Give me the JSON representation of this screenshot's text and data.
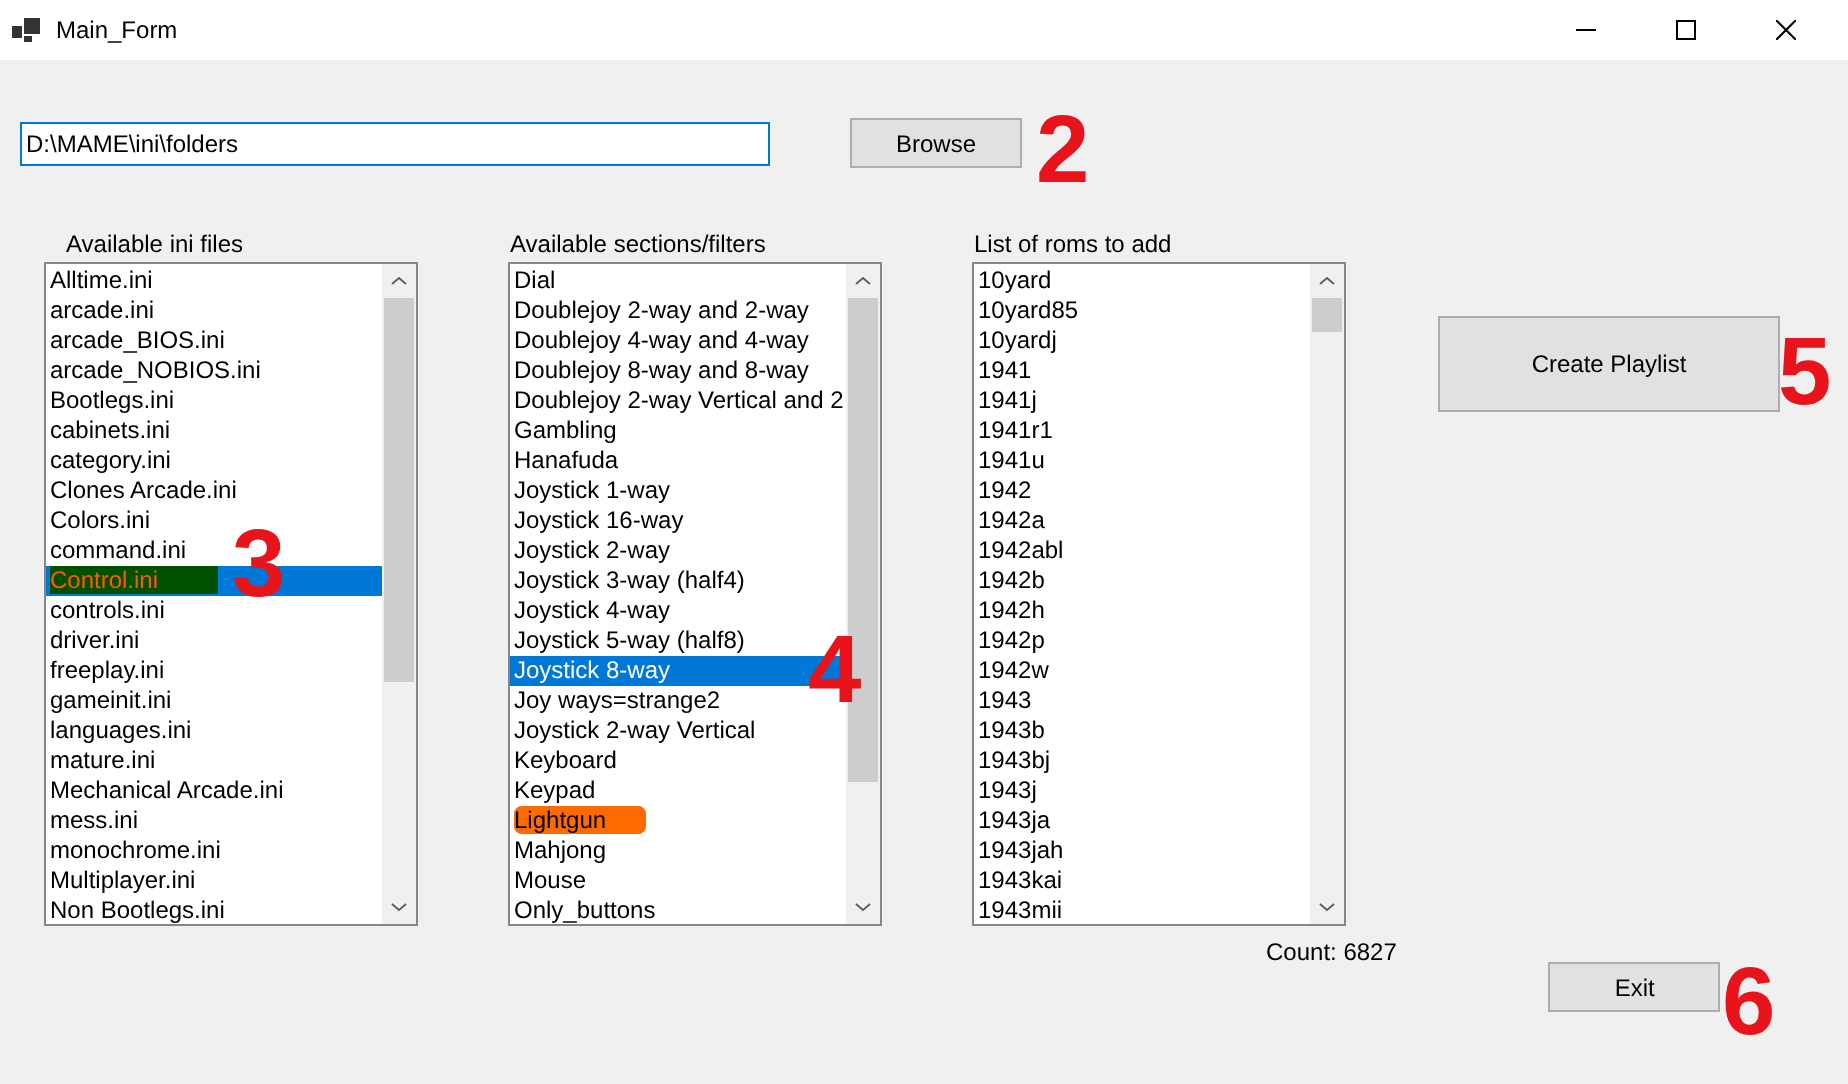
{
  "window": {
    "title": "Main_Form"
  },
  "path_field": {
    "value": "D:\\MAME\\ini\\folders"
  },
  "browse_button": "Browse",
  "lists": [
    {
      "label": "Available ini files",
      "items": [
        {
          "text": "Alltime.ini",
          "selected": false
        },
        {
          "text": "arcade.ini",
          "selected": false
        },
        {
          "text": "arcade_BIOS.ini",
          "selected": false
        },
        {
          "text": "arcade_NOBIOS.ini",
          "selected": false
        },
        {
          "text": "Bootlegs.ini",
          "selected": false
        },
        {
          "text": "cabinets.ini",
          "selected": false
        },
        {
          "text": "category.ini",
          "selected": false
        },
        {
          "text": "Clones Arcade.ini",
          "selected": false
        },
        {
          "text": "Colors.ini",
          "selected": false
        },
        {
          "text": "command.ini",
          "selected": false
        },
        {
          "text": "Control.ini",
          "selected": true,
          "highlighted": true
        },
        {
          "text": "controls.ini",
          "selected": false
        },
        {
          "text": "driver.ini",
          "selected": false
        },
        {
          "text": "freeplay.ini",
          "selected": false
        },
        {
          "text": "gameinit.ini",
          "selected": false
        },
        {
          "text": "languages.ini",
          "selected": false
        },
        {
          "text": "mature.ini",
          "selected": false
        },
        {
          "text": "Mechanical Arcade.ini",
          "selected": false
        },
        {
          "text": "mess.ini",
          "selected": false
        },
        {
          "text": "monochrome.ini",
          "selected": false
        },
        {
          "text": "Multiplayer.ini",
          "selected": false
        },
        {
          "text": "Non Bootlegs.ini",
          "selected": false
        }
      ]
    },
    {
      "label": "Available sections/filters",
      "items": [
        {
          "text": "Dial",
          "selected": false
        },
        {
          "text": "Doublejoy 2-way and 2-way",
          "selected": false
        },
        {
          "text": "Doublejoy 4-way and 4-way",
          "selected": false
        },
        {
          "text": "Doublejoy 8-way and 8-way",
          "selected": false
        },
        {
          "text": "Doublejoy 2-way Vertical and 2",
          "selected": false
        },
        {
          "text": "Gambling",
          "selected": false
        },
        {
          "text": "Hanafuda",
          "selected": false
        },
        {
          "text": "Joystick 1-way",
          "selected": false
        },
        {
          "text": "Joystick 16-way",
          "selected": false
        },
        {
          "text": "Joystick 2-way",
          "selected": false
        },
        {
          "text": "Joystick 3-way (half4)",
          "selected": false
        },
        {
          "text": "Joystick 4-way",
          "selected": false
        },
        {
          "text": "Joystick 5-way (half8)",
          "selected": false
        },
        {
          "text": "Joystick 8-way",
          "selected": true
        },
        {
          "text": "Joy ways=strange2",
          "selected": false
        },
        {
          "text": "Joystick 2-way Vertical",
          "selected": false
        },
        {
          "text": "Keyboard",
          "selected": false
        },
        {
          "text": "Keypad",
          "selected": false
        },
        {
          "text": "Lightgun",
          "selected": false,
          "highlighted": true
        },
        {
          "text": "Mahjong",
          "selected": false
        },
        {
          "text": "Mouse",
          "selected": false
        },
        {
          "text": "Only_buttons",
          "selected": false
        }
      ]
    },
    {
      "label": "List of roms to add",
      "items": [
        {
          "text": "10yard",
          "selected": false
        },
        {
          "text": "10yard85",
          "selected": false
        },
        {
          "text": "10yardj",
          "selected": false
        },
        {
          "text": "1941",
          "selected": false
        },
        {
          "text": "1941j",
          "selected": false
        },
        {
          "text": "1941r1",
          "selected": false
        },
        {
          "text": "1941u",
          "selected": false
        },
        {
          "text": "1942",
          "selected": false
        },
        {
          "text": "1942a",
          "selected": false
        },
        {
          "text": "1942abl",
          "selected": false
        },
        {
          "text": "1942b",
          "selected": false
        },
        {
          "text": "1942h",
          "selected": false
        },
        {
          "text": "1942p",
          "selected": false
        },
        {
          "text": "1942w",
          "selected": false
        },
        {
          "text": "1943",
          "selected": false
        },
        {
          "text": "1943b",
          "selected": false
        },
        {
          "text": "1943bj",
          "selected": false
        },
        {
          "text": "1943j",
          "selected": false
        },
        {
          "text": "1943ja",
          "selected": false
        },
        {
          "text": "1943jah",
          "selected": false
        },
        {
          "text": "1943kai",
          "selected": false
        },
        {
          "text": "1943mii",
          "selected": false
        }
      ]
    }
  ],
  "create_button": "Create Playlist",
  "count": "Count: 6827",
  "exit_button": "Exit",
  "annotations": [
    "2",
    "3",
    "4",
    "5",
    "6"
  ]
}
